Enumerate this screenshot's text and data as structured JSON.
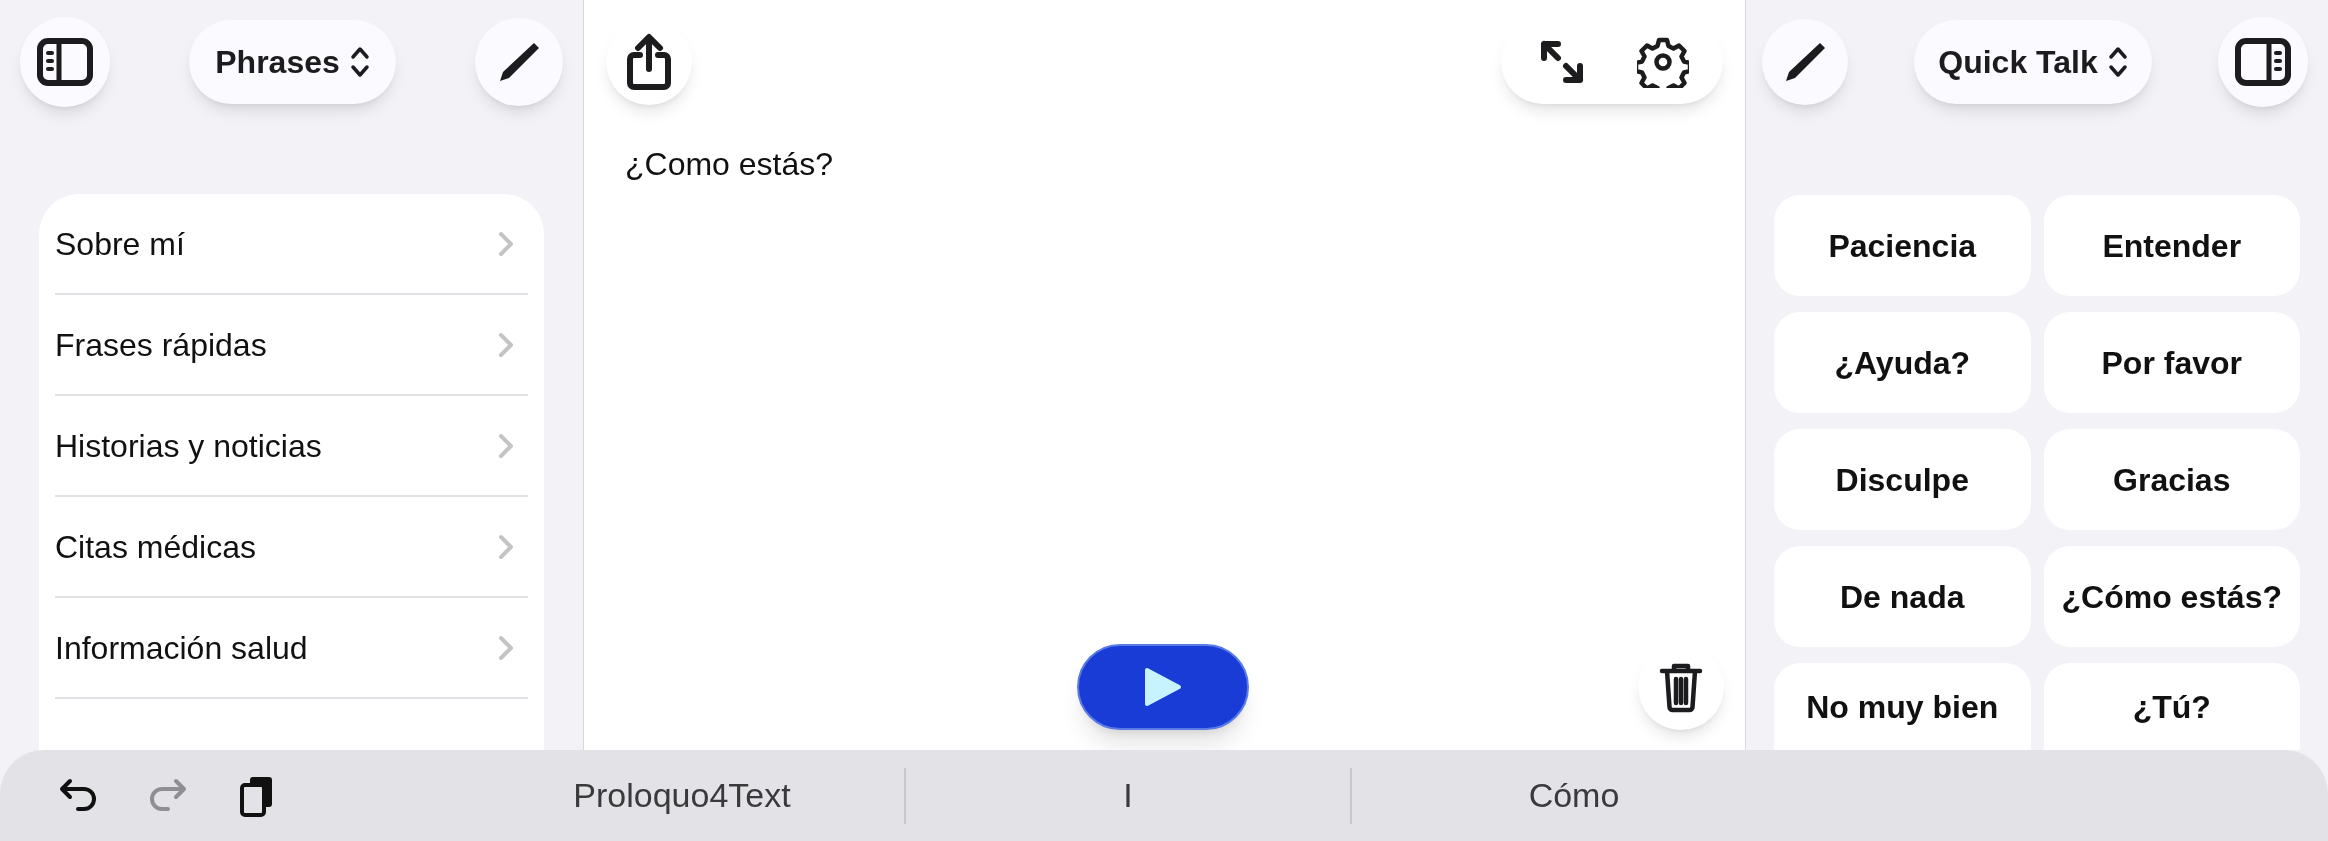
{
  "left_panel": {
    "menu": {
      "label": "Phrases"
    },
    "categories": [
      {
        "label": "Sobre mí"
      },
      {
        "label": "Frases rápidas"
      },
      {
        "label": "Historias y noticias"
      },
      {
        "label": "Citas médicas"
      },
      {
        "label": "Información salud"
      }
    ]
  },
  "editor": {
    "text": "¿Como estás?"
  },
  "right_panel": {
    "menu": {
      "label": "Quick Talk"
    },
    "phrases": [
      {
        "label": "Paciencia"
      },
      {
        "label": "Entender"
      },
      {
        "label": "¿Ayuda?"
      },
      {
        "label": "Por favor"
      },
      {
        "label": "Disculpe"
      },
      {
        "label": "Gracias"
      },
      {
        "label": "De nada"
      },
      {
        "label": "¿Cómo estás?"
      },
      {
        "label": "No muy bien"
      },
      {
        "label": "¿Tú?"
      }
    ]
  },
  "bottom_bar": {
    "actions": [
      {
        "kind": "undo",
        "disabled": false
      },
      {
        "kind": "redo",
        "disabled": true
      },
      {
        "kind": "copy",
        "disabled": false
      }
    ],
    "suggestions": [
      "Proloquo4Text",
      "I",
      "Cómo"
    ]
  }
}
